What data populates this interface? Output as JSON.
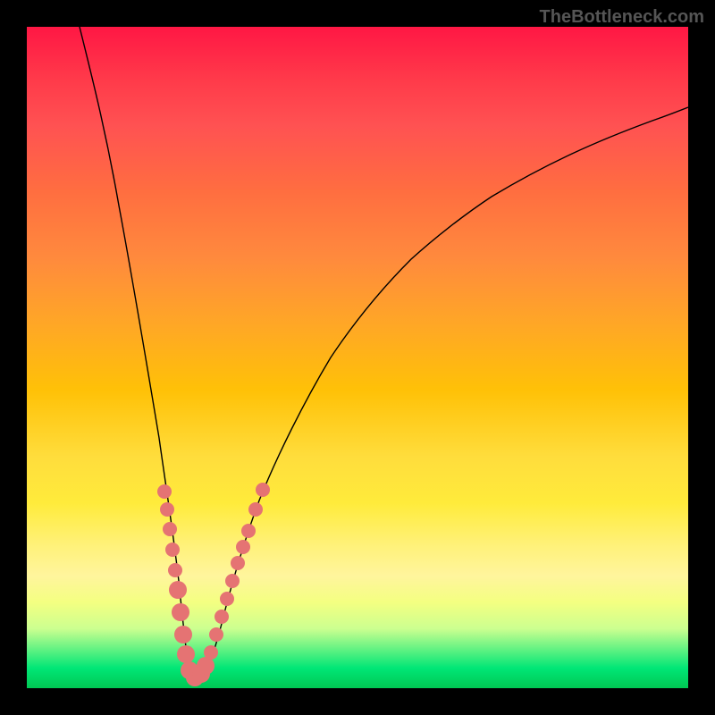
{
  "watermark": "TheBottleneck.com",
  "chart_data": {
    "type": "line",
    "title": "",
    "xlabel": "",
    "ylabel": "",
    "xlim": [
      0,
      100
    ],
    "ylim": [
      0,
      100
    ],
    "curve": {
      "description": "V-shaped bottleneck curve with minimum around x=24",
      "points": [
        {
          "x": 8,
          "y": 100
        },
        {
          "x": 10,
          "y": 92
        },
        {
          "x": 12,
          "y": 82
        },
        {
          "x": 14,
          "y": 70
        },
        {
          "x": 16,
          "y": 56
        },
        {
          "x": 18,
          "y": 42
        },
        {
          "x": 20,
          "y": 28
        },
        {
          "x": 22,
          "y": 14
        },
        {
          "x": 23,
          "y": 6
        },
        {
          "x": 24,
          "y": 2
        },
        {
          "x": 25,
          "y": 2
        },
        {
          "x": 26,
          "y": 3
        },
        {
          "x": 28,
          "y": 10
        },
        {
          "x": 30,
          "y": 18
        },
        {
          "x": 32,
          "y": 26
        },
        {
          "x": 35,
          "y": 36
        },
        {
          "x": 40,
          "y": 48
        },
        {
          "x": 45,
          "y": 57
        },
        {
          "x": 50,
          "y": 64
        },
        {
          "x": 55,
          "y": 70
        },
        {
          "x": 60,
          "y": 74
        },
        {
          "x": 65,
          "y": 78
        },
        {
          "x": 70,
          "y": 81
        },
        {
          "x": 75,
          "y": 84
        },
        {
          "x": 80,
          "y": 87
        },
        {
          "x": 85,
          "y": 89
        },
        {
          "x": 90,
          "y": 91
        },
        {
          "x": 95,
          "y": 93
        },
        {
          "x": 100,
          "y": 94
        }
      ]
    },
    "series": [
      {
        "name": "data-markers",
        "points": [
          {
            "x": 19.5,
            "y": 30,
            "size": 8
          },
          {
            "x": 20,
            "y": 27,
            "size": 8
          },
          {
            "x": 20.5,
            "y": 23,
            "size": 8
          },
          {
            "x": 21,
            "y": 19,
            "size": 8
          },
          {
            "x": 21.5,
            "y": 15,
            "size": 8
          },
          {
            "x": 22,
            "y": 12,
            "size": 10
          },
          {
            "x": 22.5,
            "y": 9,
            "size": 10
          },
          {
            "x": 23,
            "y": 6,
            "size": 10
          },
          {
            "x": 23.5,
            "y": 4,
            "size": 10
          },
          {
            "x": 24,
            "y": 2,
            "size": 10
          },
          {
            "x": 25,
            "y": 2,
            "size": 10
          },
          {
            "x": 26,
            "y": 3,
            "size": 10
          },
          {
            "x": 26.5,
            "y": 5,
            "size": 10
          },
          {
            "x": 27,
            "y": 7,
            "size": 8
          },
          {
            "x": 28,
            "y": 10,
            "size": 8
          },
          {
            "x": 28.5,
            "y": 13,
            "size": 8
          },
          {
            "x": 29,
            "y": 15,
            "size": 8
          },
          {
            "x": 30,
            "y": 18,
            "size": 8
          },
          {
            "x": 30.5,
            "y": 20,
            "size": 8
          },
          {
            "x": 31,
            "y": 22,
            "size": 8
          },
          {
            "x": 32,
            "y": 26,
            "size": 8
          },
          {
            "x": 33,
            "y": 30,
            "size": 8
          },
          {
            "x": 34,
            "y": 33,
            "size": 8
          }
        ]
      }
    ]
  }
}
